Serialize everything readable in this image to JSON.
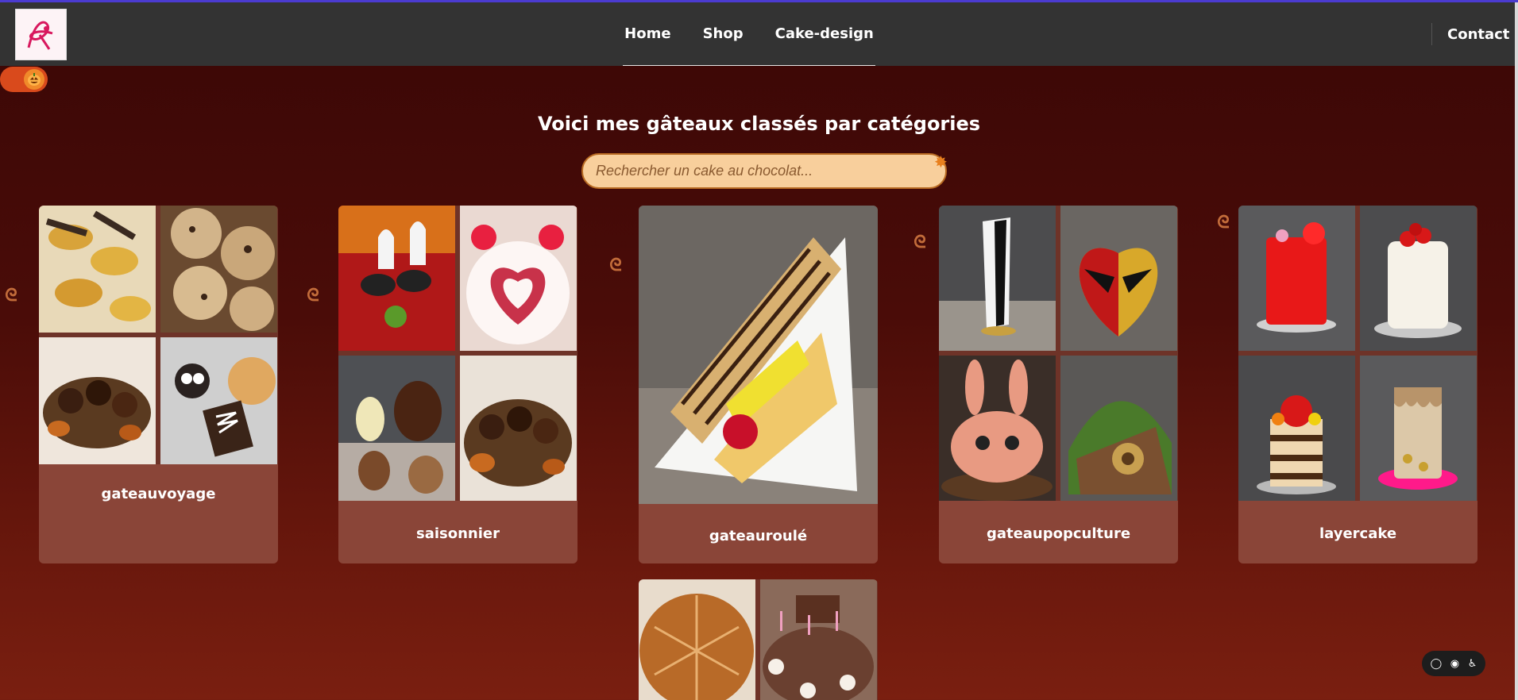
{
  "header": {
    "logo_alt": "logo",
    "nav": [
      "Home",
      "Shop",
      "Cake-design"
    ],
    "contact": "Contact"
  },
  "main": {
    "title": "Voici mes gâteaux classés par catégories",
    "search_placeholder": "Rechercher un cake au chocolat..."
  },
  "categories": [
    {
      "label": "gateauvoyage"
    },
    {
      "label": "saisonnier"
    },
    {
      "label": "gateauroulé"
    },
    {
      "label": "gateaupopculture"
    },
    {
      "label": "layercake"
    }
  ],
  "icons": {
    "toggle": "pumpkin-icon",
    "search_decoration": "maple-leaf-icon",
    "card_decoration": "croissant-icon",
    "accessibility": [
      "comment-icon",
      "eye-icon",
      "accessibility-icon"
    ]
  },
  "colors": {
    "header_bg": "#333333",
    "card_bg": "#8a4538",
    "search_bg": "#f8cf9c",
    "page_bg_top": "#3a0706",
    "page_bg_bottom": "#7a1f10"
  }
}
